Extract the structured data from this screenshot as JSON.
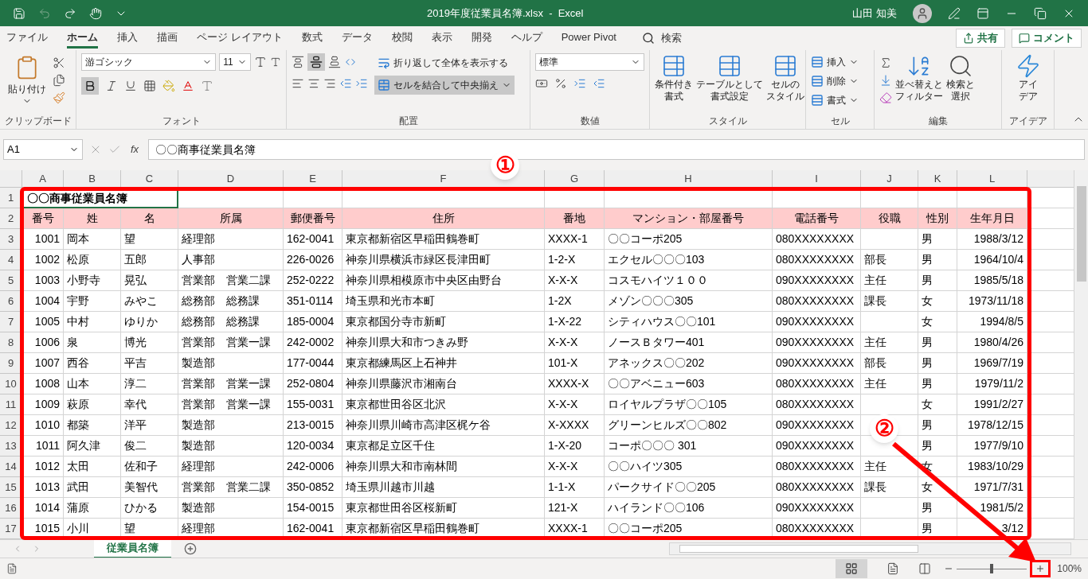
{
  "title_bar": {
    "title": "2019年度従業員名簿.xlsx  -  Excel",
    "user": "山田 知美"
  },
  "menu_tabs": [
    {
      "label": "ファイル",
      "selected": false
    },
    {
      "label": "ホーム",
      "selected": true
    },
    {
      "label": "挿入",
      "selected": false
    },
    {
      "label": "描画",
      "selected": false
    },
    {
      "label": "ページ レイアウト",
      "selected": false
    },
    {
      "label": "数式",
      "selected": false
    },
    {
      "label": "データ",
      "selected": false
    },
    {
      "label": "校閲",
      "selected": false
    },
    {
      "label": "表示",
      "selected": false
    },
    {
      "label": "開発",
      "selected": false
    },
    {
      "label": "ヘルプ",
      "selected": false
    },
    {
      "label": "Power Pivot",
      "selected": false
    }
  ],
  "search": {
    "label": "検索"
  },
  "share_button": "共有",
  "comment_button": "コメント",
  "ribbon": {
    "clipboard": {
      "paste": "貼り付け",
      "label": "クリップボード"
    },
    "font": {
      "name": "游ゴシック",
      "size": "11",
      "bold_button": {
        "on": true
      },
      "label": "フォント"
    },
    "alignment": {
      "middle_align": {
        "on": true
      },
      "wrap_text": "折り返して全体を表示する",
      "merge": {
        "label": "セルを結合して中央揃え",
        "on": true
      },
      "label": "配置"
    },
    "number": {
      "format": "標準",
      "label": "数値"
    },
    "styles": {
      "buttons": [
        {
          "lines": [
            "条件付き",
            "書式"
          ]
        },
        {
          "lines": [
            "テーブルとして",
            "書式設定"
          ]
        },
        {
          "lines": [
            "セルの",
            "スタイル"
          ]
        }
      ],
      "label": "スタイル"
    },
    "cells": {
      "buttons": [
        "挿入",
        "削除",
        "書式"
      ],
      "label": "セル"
    },
    "editing": {
      "buttons": [
        {
          "lines": [
            "並べ替えと",
            "フィルター"
          ]
        },
        {
          "lines": [
            "検索と",
            "選択"
          ]
        }
      ],
      "label": "編集"
    },
    "ideas": {
      "button": {
        "lines": [
          "アイ",
          "デア"
        ]
      },
      "label": "アイデア"
    }
  },
  "formula_bar": {
    "name_box": "A1",
    "function_label": "fx",
    "formula": "〇〇商事従業員名簿"
  },
  "sheet": {
    "columns": [
      "A",
      "B",
      "C",
      "D",
      "E",
      "F",
      "G",
      "H",
      "I",
      "J",
      "K",
      "L"
    ],
    "title_row": {
      "number": "1",
      "text": "〇〇商事従業員名簿",
      "selected": true
    },
    "header_row": {
      "number": "2",
      "cells": [
        "番号",
        "姓",
        "名",
        "所属",
        "郵便番号",
        "住所",
        "番地",
        "マンション・部屋番号",
        "電話番号",
        "役職",
        "性別",
        "生年月日"
      ]
    },
    "rows": [
      {
        "number": "3",
        "cells": [
          "1001",
          "岡本",
          "望",
          "経理部",
          "162-0041",
          "東京都新宿区早稲田鶴巻町",
          "XXXX-1",
          "〇〇コーポ205",
          "080XXXXXXXX",
          "",
          "男",
          "1988/3/12"
        ]
      },
      {
        "number": "4",
        "cells": [
          "1002",
          "松原",
          "五郎",
          "人事部",
          "226-0026",
          "神奈川県横浜市緑区長津田町",
          "1-2-X",
          "エクセル〇〇〇103",
          "080XXXXXXXX",
          "部長",
          "男",
          "1964/10/4"
        ]
      },
      {
        "number": "5",
        "cells": [
          "1003",
          "小野寺",
          "晃弘",
          "営業部　営業二課",
          "252-0222",
          "神奈川県相模原市中央区由野台",
          "X-X-X",
          "コスモハイツ１００",
          "090XXXXXXXX",
          "主任",
          "男",
          "1985/5/18"
        ]
      },
      {
        "number": "6",
        "cells": [
          "1004",
          "宇野",
          "みやこ",
          "総務部　総務課",
          "351-0114",
          "埼玉県和光市本町",
          "1-2X",
          "メゾン〇〇〇305",
          "080XXXXXXXX",
          "課長",
          "女",
          "1973/11/18"
        ]
      },
      {
        "number": "7",
        "cells": [
          "1005",
          "中村",
          "ゆりか",
          "総務部　総務課",
          "185-0004",
          "東京都国分寺市新町",
          "1-X-22",
          "シティハウス〇〇101",
          "090XXXXXXXX",
          "",
          "女",
          "1994/8/5"
        ]
      },
      {
        "number": "8",
        "cells": [
          "1006",
          "泉",
          "博光",
          "営業部　営業一課",
          "242-0002",
          "神奈川県大和市つきみ野",
          "X-X-X",
          "ノースＢタワー401",
          "090XXXXXXXX",
          "主任",
          "男",
          "1980/4/26"
        ]
      },
      {
        "number": "9",
        "cells": [
          "1007",
          "西谷",
          "平吉",
          "製造部",
          "177-0044",
          "東京都練馬区上石神井",
          "101-X",
          "アネックス〇〇202",
          "090XXXXXXXX",
          "部長",
          "男",
          "1969/7/19"
        ]
      },
      {
        "number": "10",
        "cells": [
          "1008",
          "山本",
          "淳二",
          "営業部　営業一課",
          "252-0804",
          "神奈川県藤沢市湘南台",
          "XXXX-X",
          "〇〇アベニュー603",
          "080XXXXXXXX",
          "主任",
          "男",
          "1979/11/2"
        ]
      },
      {
        "number": "11",
        "cells": [
          "1009",
          "萩原",
          "幸代",
          "営業部　営業一課",
          "155-0031",
          "東京都世田谷区北沢",
          "X-X-X",
          "ロイヤルプラザ〇〇105",
          "080XXXXXXXX",
          "",
          "女",
          "1991/2/27"
        ]
      },
      {
        "number": "12",
        "cells": [
          "1010",
          "都築",
          "洋平",
          "製造部",
          "213-0015",
          "神奈川県川崎市高津区梶ケ谷",
          "X-XXXX",
          "グリーンヒルズ〇〇802",
          "090XXXXXXXX",
          "",
          "男",
          "1978/12/15"
        ]
      },
      {
        "number": "13",
        "cells": [
          "1011",
          "阿久津",
          "俊二",
          "製造部",
          "120-0034",
          "東京都足立区千住",
          "1-X-20",
          "コーポ〇〇〇 301",
          "090XXXXXXXX",
          "",
          "男",
          "1977/9/10"
        ]
      },
      {
        "number": "14",
        "cells": [
          "1012",
          "太田",
          "佐和子",
          "経理部",
          "242-0006",
          "神奈川県大和市南林間",
          "X-X-X",
          "〇〇ハイツ305",
          "080XXXXXXXX",
          "主任",
          "女",
          "1983/10/29"
        ]
      },
      {
        "number": "15",
        "cells": [
          "1013",
          "武田",
          "美智代",
          "営業部　営業二課",
          "350-0852",
          "埼玉県川越市川越",
          "1-1-X",
          "パークサイド〇〇205",
          "080XXXXXXXX",
          "課長",
          "女",
          "1971/7/31"
        ]
      },
      {
        "number": "16",
        "cells": [
          "1014",
          "蒲原",
          "ひかる",
          "製造部",
          "154-0015",
          "東京都世田谷区桜新町",
          "121-X",
          "ハイランド〇〇106",
          "090XXXXXXXX",
          "",
          "男",
          "1981/5/2"
        ]
      },
      {
        "number": "17",
        "cells": [
          "1015",
          "小川",
          "望",
          "経理部",
          "162-0041",
          "東京都新宿区早稲田鶴巻町",
          "XXXX-1",
          "〇〇コーポ205",
          "080XXXXXXXX",
          "",
          "男",
          "3/12"
        ]
      }
    ]
  },
  "sheet_tabs": [
    {
      "label": "従業員名簿",
      "selected": true
    }
  ],
  "status_bar": {
    "zoom": "100%",
    "zoom_slider": {
      "level": 0.5
    }
  },
  "annotations": [
    "①",
    "②"
  ]
}
